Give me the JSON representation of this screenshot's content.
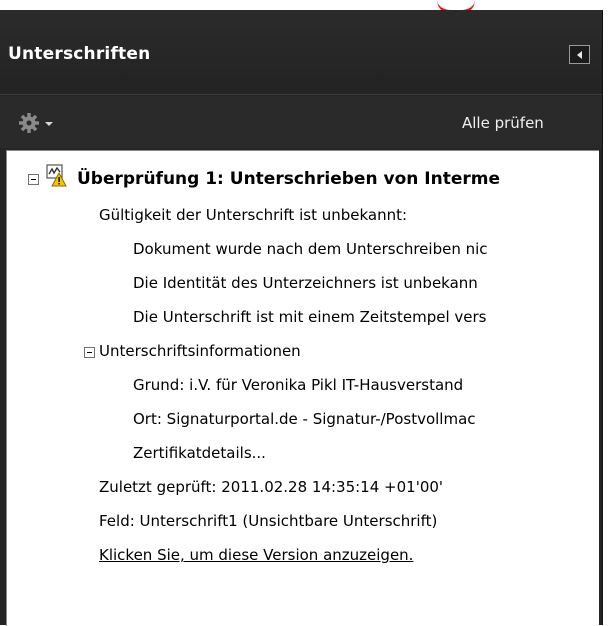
{
  "header": {
    "title": "Unterschriften"
  },
  "toolbar": {
    "verify_all_label": "Alle prüfen"
  },
  "tree": {
    "verification_title": "Überprüfung 1: Unterschrieben von Interme",
    "validity_unknown": "Gültigkeit der Unterschrift ist unbekannt:",
    "detail_doc_changed": "Dokument wurde nach dem Unterschreiben nic",
    "detail_identity": "Die Identität des Unterzeichners ist unbekann",
    "detail_timestamp": "Die Unterschrift ist mit einem Zeitstempel vers",
    "signature_info": "Unterschriftsinformationen",
    "reason": "Grund: i.V. für Veronika Pikl IT-Hausverstand",
    "location": "Ort: Signaturportal.de - Signatur-/Postvollmac",
    "certificate_details": "Zertifikatdetails...",
    "last_checked": "Zuletzt geprüft: 2011.02.28 14:35:14 +01'00'",
    "field": "Feld: Unterschrift1 (Unsichtbare Unterschrift)",
    "view_version_link": "Klicken Sie, um diese Version anzuzeigen."
  },
  "icons": {
    "gear": "gear-icon",
    "collapse": "collapse-panel-icon",
    "signature_warning": "signature-warning-icon"
  },
  "colors": {
    "panel_bg": "#252525",
    "content_bg": "#ffffff",
    "warning_yellow": "#f5c400",
    "accent_red": "#e8141b"
  }
}
